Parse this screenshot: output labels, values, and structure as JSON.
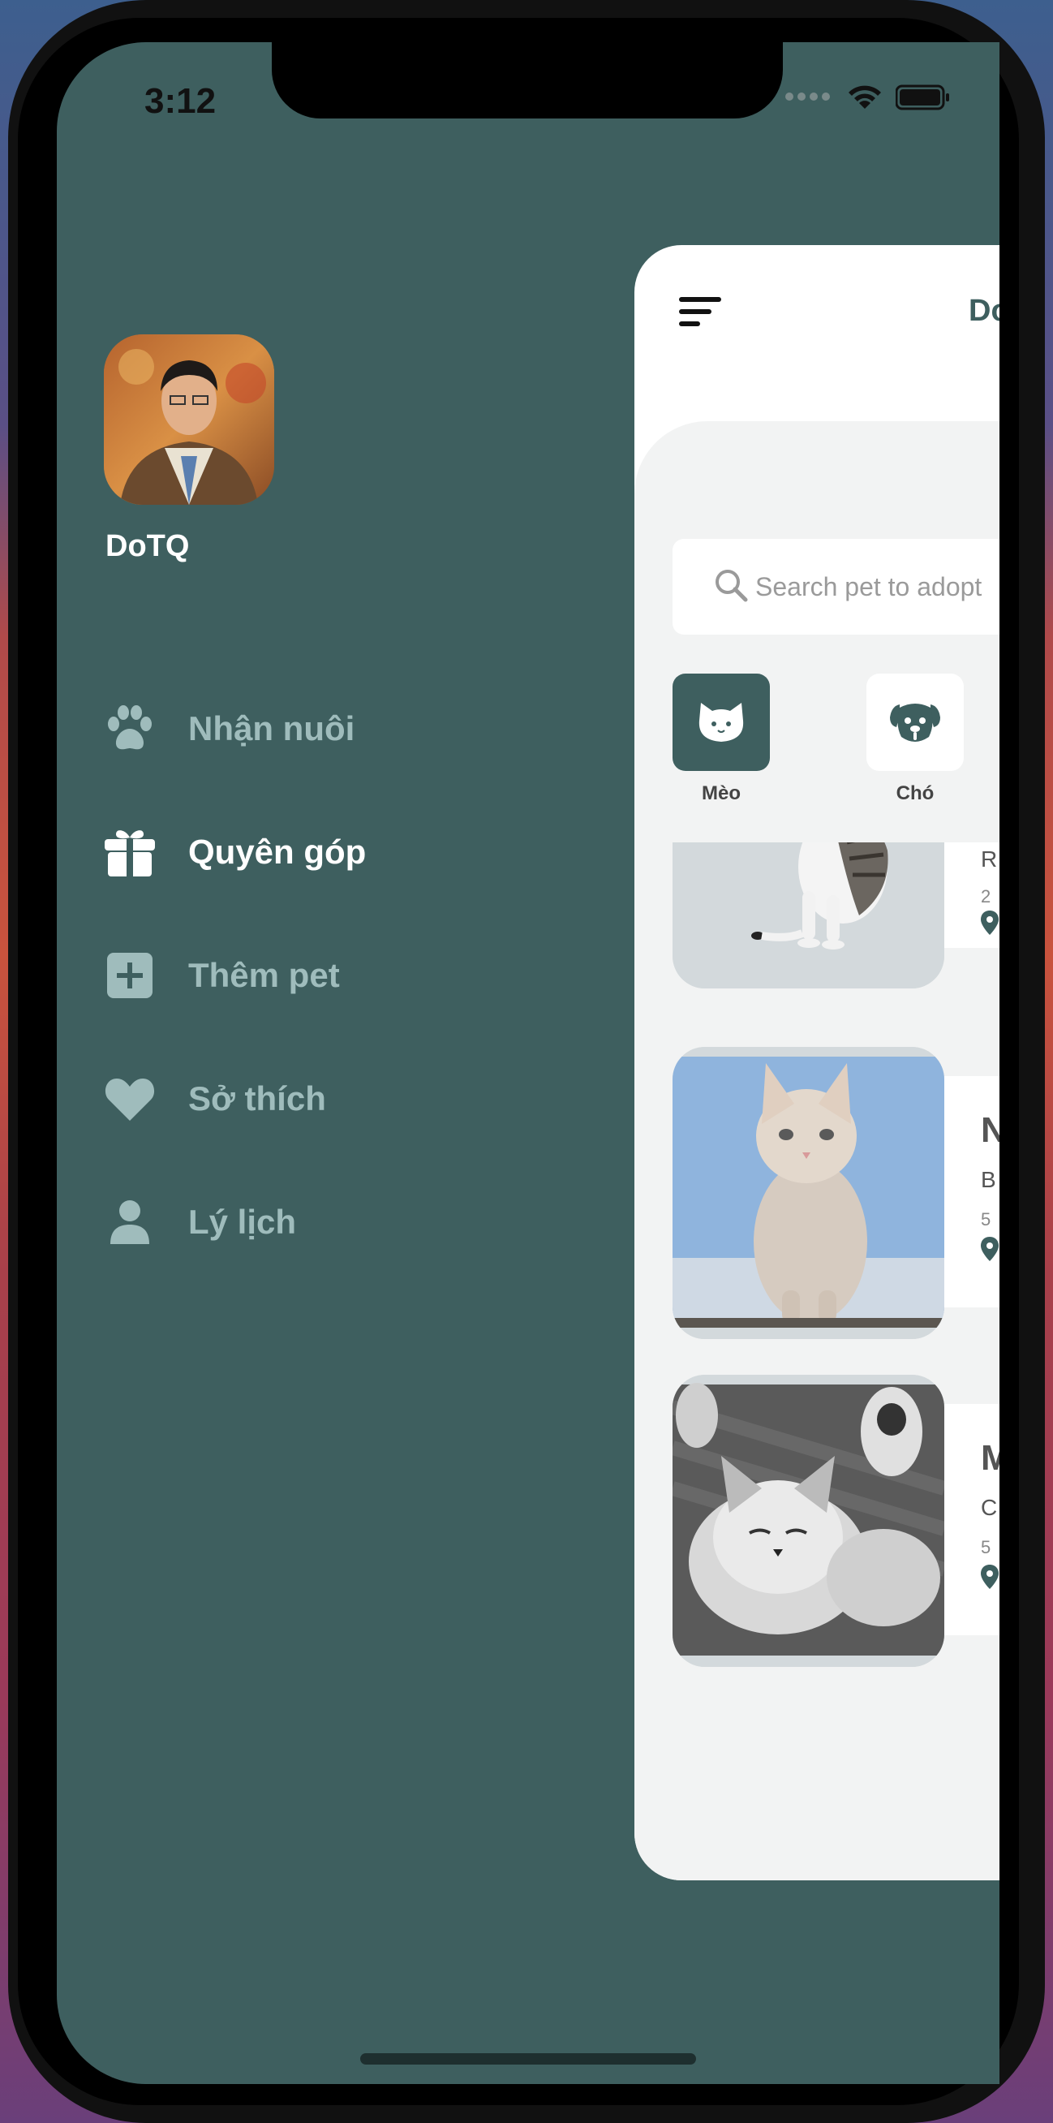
{
  "status_bar": {
    "time": "3:12"
  },
  "profile": {
    "name": "DoTQ"
  },
  "menu": [
    {
      "label": "Nhận nuôi",
      "icon": "paw-icon",
      "active": false
    },
    {
      "label": "Quyên góp",
      "icon": "gift-icon",
      "active": true
    },
    {
      "label": "Thêm pet",
      "icon": "plus-square-icon",
      "active": false
    },
    {
      "label": "Sở thích",
      "icon": "heart-icon",
      "active": false
    },
    {
      "label": "Lý lịch",
      "icon": "user-icon",
      "active": false
    }
  ],
  "panel": {
    "title": "Do",
    "search_placeholder": "Search pet to adopt",
    "categories": [
      {
        "label": "Mèo",
        "icon": "cat-icon",
        "selected": true
      },
      {
        "label": "Chó",
        "icon": "dog-icon",
        "selected": false
      }
    ],
    "pets": [
      {
        "name": "",
        "breed": "R",
        "age": "2",
        "image": "white-gray-cat"
      },
      {
        "name": "N",
        "breed": "B",
        "age": "5",
        "image": "white-kitten-sky"
      },
      {
        "name": "M",
        "breed": "C",
        "age": "5",
        "image": "bw-sleeping-cat"
      }
    ]
  },
  "colors": {
    "drawer_bg": "#3e5f5f",
    "menu_inactive": "#9fbcbc",
    "menu_active": "#ffffff",
    "accent": "#3e5f5f"
  }
}
